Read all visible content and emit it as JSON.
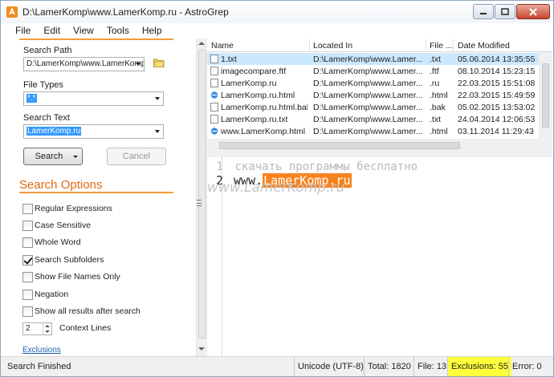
{
  "window": {
    "title": "D:\\LamerKomp\\www.LamerKomp.ru - AstroGrep"
  },
  "menu": [
    "File",
    "Edit",
    "View",
    "Tools",
    "Help"
  ],
  "search": {
    "path_label": "Search Path",
    "path_value": "D:\\LamerKomp\\www.LamerKomp",
    "filetypes_label": "File Types",
    "filetypes_value": "*.*",
    "text_label": "Search Text",
    "text_value": "LamerKomp.ru",
    "search_button": "Search",
    "cancel_button": "Cancel"
  },
  "options": {
    "title": "Search Options",
    "items": [
      {
        "label": "Regular Expressions",
        "checked": false
      },
      {
        "label": "Case Sensitive",
        "checked": false
      },
      {
        "label": "Whole Word",
        "checked": false
      },
      {
        "label": "Search Subfolders",
        "checked": true
      },
      {
        "label": "Show File Names Only",
        "checked": false
      },
      {
        "label": "Negation",
        "checked": false
      },
      {
        "label": "Show all results after search",
        "checked": false
      }
    ],
    "context_value": "2",
    "context_label": "Context Lines",
    "exclusions_link": "Exclusions"
  },
  "grid": {
    "headers": [
      "Name",
      "Located In",
      "File ...",
      "Date Modified"
    ],
    "rows": [
      {
        "name": "1.txt",
        "location": "D:\\LamerKomp\\www.Lamer...",
        "ext": ".txt",
        "date": "05.06.2014 13:35:55",
        "icon": "text-file-icon"
      },
      {
        "name": "imagecompare.ftf",
        "location": "D:\\LamerKomp\\www.Lamer...",
        "ext": ".ftf",
        "date": "08.10.2014 15:23:15",
        "icon": "blank-file-icon"
      },
      {
        "name": "LamerKomp.ru",
        "location": "D:\\LamerKomp\\www.Lamer...",
        "ext": ".ru",
        "date": "22.03.2015 15:51:08",
        "icon": "blank-file-icon"
      },
      {
        "name": "LamerKomp.ru.html",
        "location": "D:\\LamerKomp\\www.Lamer...",
        "ext": ".html",
        "date": "22.03.2015 15:49:59",
        "icon": "html-file-icon"
      },
      {
        "name": "LamerKomp.ru.html.bak",
        "location": "D:\\LamerKomp\\www.Lamer...",
        "ext": ".bak",
        "date": "05.02.2015 13:53:02",
        "icon": "blank-file-icon"
      },
      {
        "name": "LamerKomp.ru.txt",
        "location": "D:\\LamerKomp\\www.Lamer...",
        "ext": ".txt",
        "date": "24.04.2014 12:06:53",
        "icon": "text-file-icon"
      },
      {
        "name": "www.LamerKomp.html",
        "location": "D:\\LamerKomp\\www.Lamer...",
        "ext": ".html",
        "date": "03.11.2014 11:29:43",
        "icon": "html-file-icon"
      }
    ]
  },
  "viewer": {
    "line1_num": "1",
    "line1_text": "скачать программы бесплатно",
    "line2_num": "2",
    "line2_prefix": "www.",
    "line2_hit": "LamerKomp.ru",
    "watermark": "www.LamerKomp.ru"
  },
  "status": {
    "message": "Search Finished",
    "encoding": "Unicode (UTF-8)",
    "total": "Total: 1820",
    "file": "File: 13",
    "exclusions": "Exclusions: 55",
    "error": "Error: 0"
  },
  "colors": {
    "accent": "#f39c3a",
    "highlight": "#f7831e",
    "selection": "#cce8ff",
    "status_highlight": "#ffff3c"
  }
}
